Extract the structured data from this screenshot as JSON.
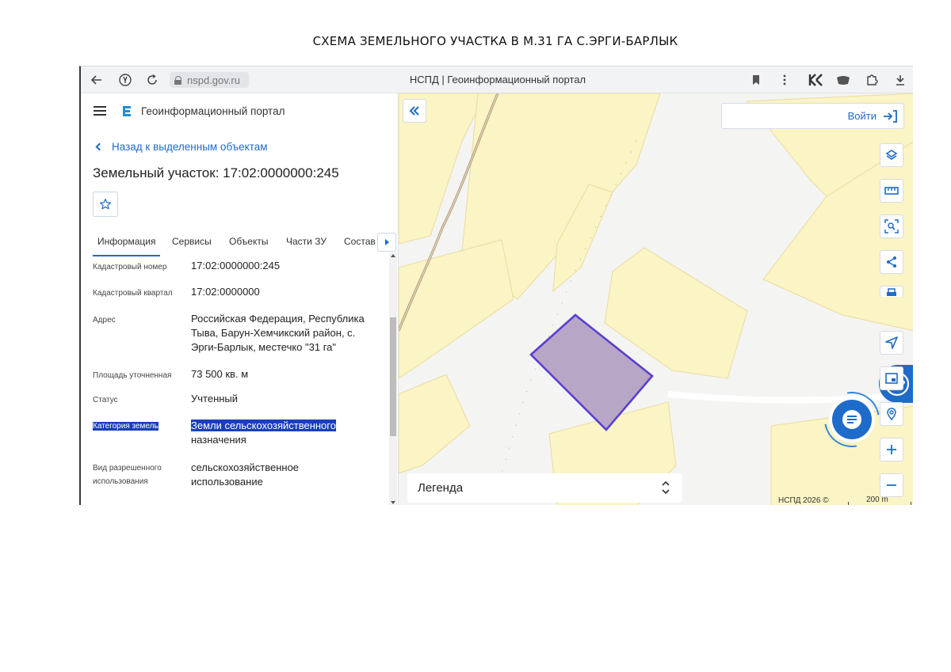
{
  "document": {
    "title": "СХЕМА ЗЕМЕЛЬНОГО УЧАСТКА В М.31 ГА С.ЭРГИ-БАРЛЫК"
  },
  "browser": {
    "url": "nspd.gov.ru",
    "tab_title": "НСПД | Геоинформационный портал"
  },
  "sidebar": {
    "app_title": "Геоинформационный портал",
    "back_link": "Назад к выделенным объектам",
    "object_title": "Земельный участок: 17:02:0000000:245",
    "tabs": [
      {
        "label": "Информация",
        "active": true
      },
      {
        "label": "Сервисы"
      },
      {
        "label": "Объекты"
      },
      {
        "label": "Части ЗУ"
      },
      {
        "label": "Состав"
      }
    ],
    "info_rows": [
      {
        "label": "Кадастровый номер",
        "value": "17:02:0000000:245"
      },
      {
        "label": "Кадастровый квартал",
        "value": "17:02:0000000"
      },
      {
        "label": "Адрес",
        "value_lines": [
          "Российская Федерация, Республика",
          "Тыва, Барун-Хемчикский район, с.",
          "Эрги-Барлык, местечко \"31 га\""
        ]
      },
      {
        "label": "Площадь уточненная",
        "value": "73 500 кв. м"
      },
      {
        "label": "Статус",
        "value": "Учтенный"
      },
      {
        "label": "Категория земель",
        "value_lines": [
          "Земли сельскохозяйственного",
          "назначения"
        ]
      },
      {
        "label_lines": [
          "Вид разрешенного",
          "использования"
        ],
        "value_lines": [
          "сельскохозяйственное",
          "использование"
        ]
      }
    ]
  },
  "map": {
    "login_label": "Войти",
    "legend_label": "Легенда",
    "copyright": "НСПД 2026 ©",
    "scale_label": "200 m",
    "colors": {
      "parcel_fill": "#b8a6c6",
      "parcel_stroke": "#5a3fd1",
      "land_yellow": "#fbf4c4",
      "accent": "#1e6bc9"
    }
  }
}
